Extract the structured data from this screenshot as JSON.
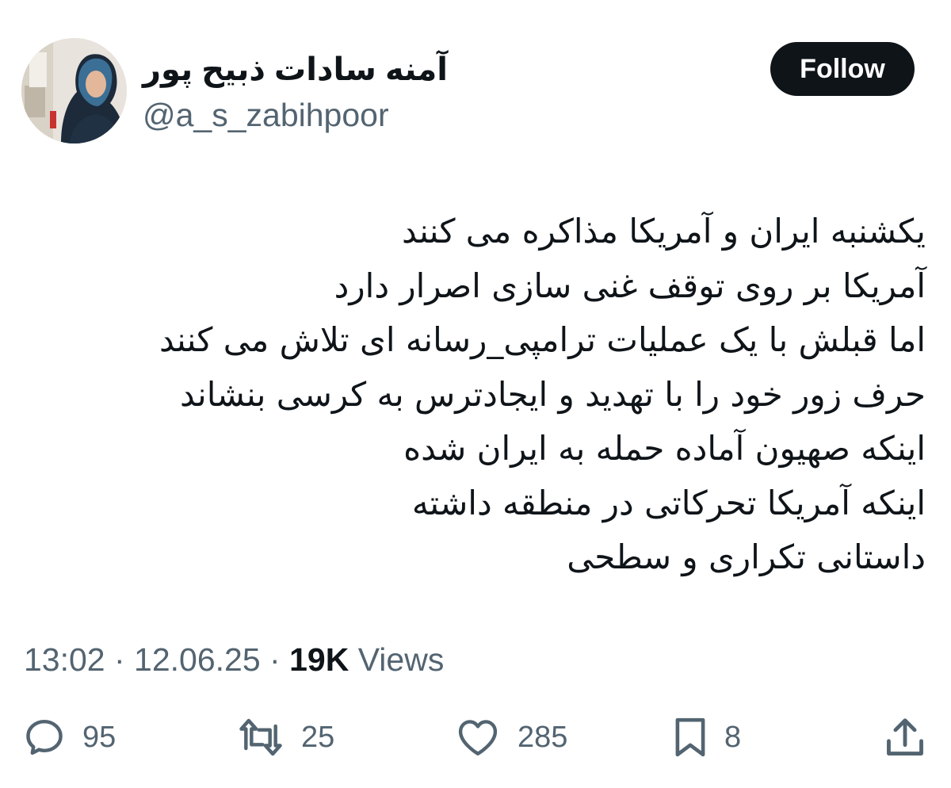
{
  "author": {
    "display_name": "آمنه سادات ذبیح پور",
    "handle": "@a_s_zabihpoor",
    "avatar_icon": "user-avatar-photo"
  },
  "follow_button": {
    "label": "Follow"
  },
  "tweet": {
    "lines": [
      "یکشنبه ایران و آمریکا مذاکره می کنند",
      "آمریکا بر روی توقف غنی سازی اصرار دارد",
      "اما قبلش با یک عملیات ترامپی_رسانه ای تلاش می کنند",
      "حرف زور خود را با تهدید و ایجادترس به کرسی بنشاند",
      "اینکه صهیون آماده حمله به ایران شده",
      "اینکه آمریکا تحرکاتی در منطقه داشته",
      "داستانی تکراری و سطحی"
    ]
  },
  "meta": {
    "time": "13:02",
    "separator": " · ",
    "date": "12.06.25",
    "views_count": "19K",
    "views_label": " Views"
  },
  "actions": {
    "reply": {
      "icon": "reply-icon",
      "count": "95"
    },
    "retweet": {
      "icon": "retweet-icon",
      "count": "25"
    },
    "like": {
      "icon": "heart-icon",
      "count": "285"
    },
    "bookmark": {
      "icon": "bookmark-icon",
      "count": "8"
    },
    "share": {
      "icon": "share-icon"
    }
  },
  "colors": {
    "text_primary": "#0f1419",
    "text_secondary": "#536471",
    "button_bg": "#0f1419",
    "button_text": "#ffffff",
    "background": "#ffffff"
  }
}
